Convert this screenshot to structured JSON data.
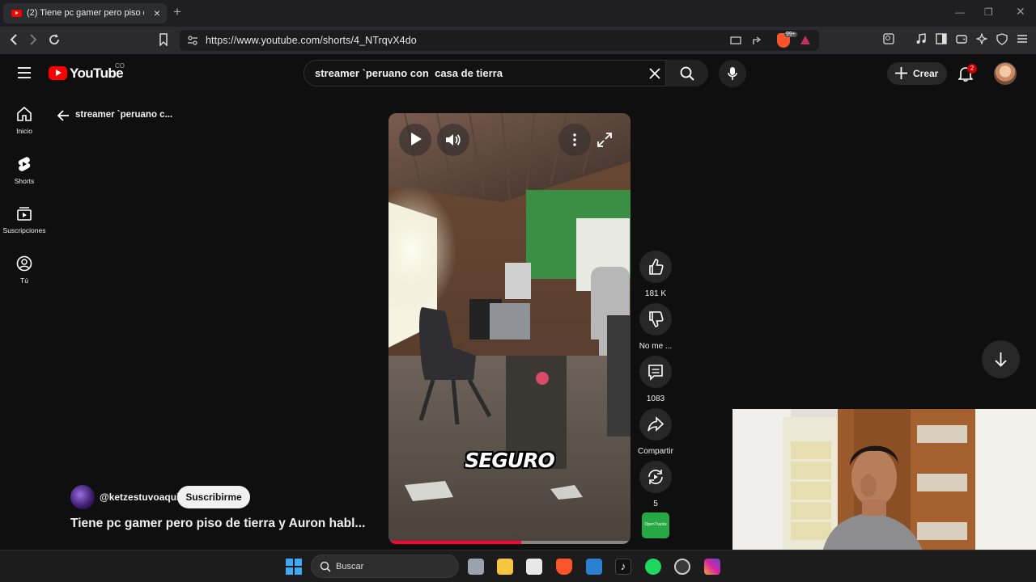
{
  "browser": {
    "tab_title": "(2) Tiene pc gamer pero piso de",
    "url": "https://www.youtube.com/shorts/4_NTrqvX4do",
    "extension_badge": "99+"
  },
  "header": {
    "logo_text": "YouTube",
    "logo_country": "CO",
    "search_value": "streamer `peruano con  casa de tierra",
    "create_label": "Crear",
    "notification_count": "2"
  },
  "sidebar": {
    "items": [
      {
        "label": "Inicio",
        "icon": "home-icon"
      },
      {
        "label": "Shorts",
        "icon": "shorts-icon"
      },
      {
        "label": "Suscripciones",
        "icon": "subscriptions-icon"
      },
      {
        "label": "Tú",
        "icon": "user-icon"
      }
    ]
  },
  "shorts": {
    "back_title": "streamer `peruano c...",
    "channel": "@ketzestuvoaqui",
    "subscribe_label": "Suscribirme",
    "video_title": "Tiene pc gamer pero piso de tierra y Auron habl...",
    "caption": "SEGURO",
    "progress": 0.55,
    "actions": {
      "like_count": "181 K",
      "dislike_label": "No me ...",
      "comments_count": "1083",
      "share_label": "Compartir",
      "remix_count": "5"
    },
    "sound_label": "OpenTracks"
  },
  "taskbar": {
    "search_placeholder": "Buscar"
  },
  "colors": {
    "brand_red": "#ff0000",
    "progress_red": "#ff0033",
    "background": "#0f0f0f"
  }
}
